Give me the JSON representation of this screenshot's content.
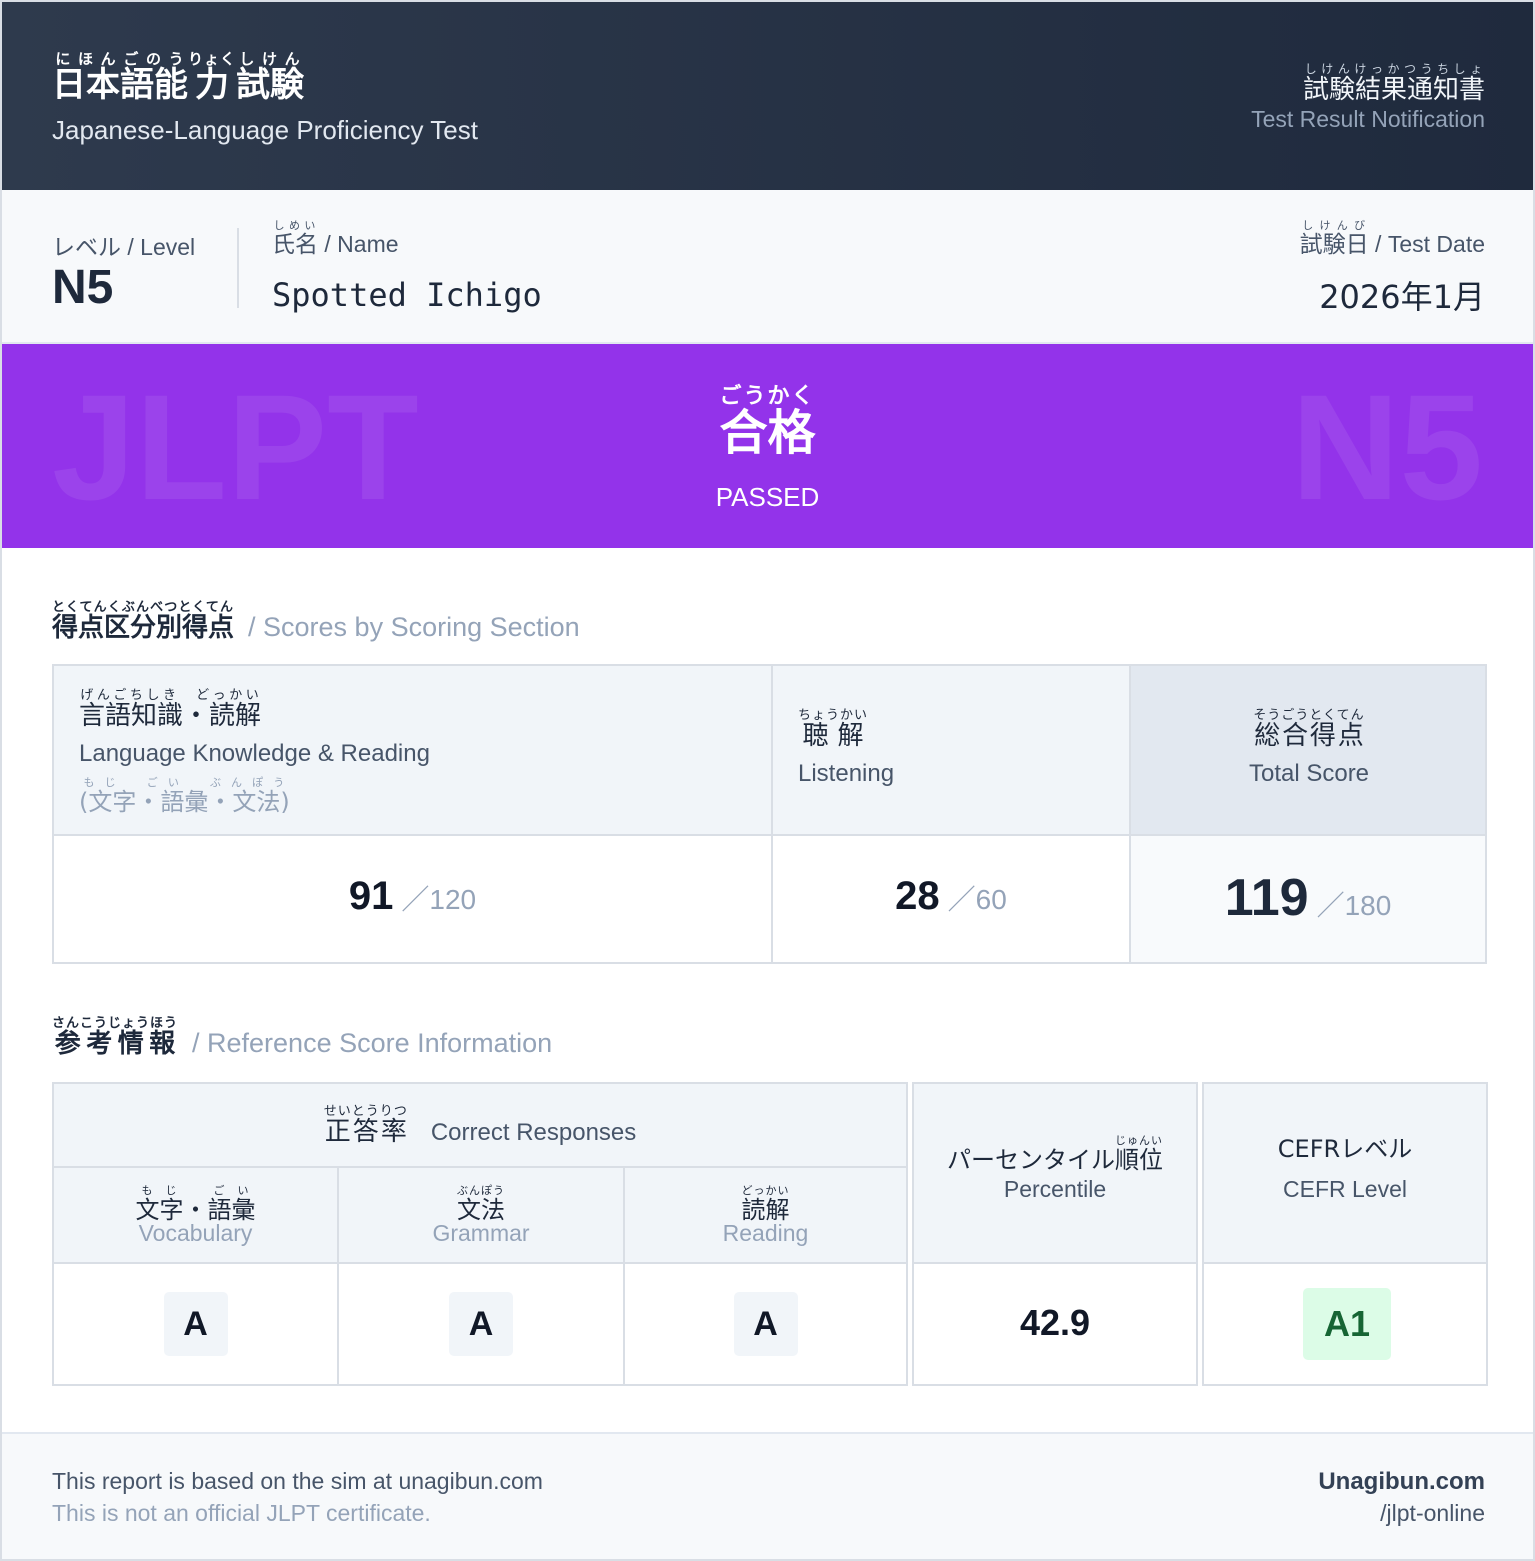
{
  "header": {
    "title_parts": [
      {
        "kanji": "日本語能",
        "reading": "にほんごのう"
      },
      {
        "kanji": "力",
        "reading": "りょく"
      },
      {
        "kanji": "試験",
        "reading": "しけん"
      }
    ],
    "subtitle": "Japanese-Language Proficiency Test",
    "notice_jp": "試験結果通知書",
    "notice_reading": "しけんけっかつうちしょ",
    "notice_en": "Test Result Notification"
  },
  "info": {
    "level_label": "レベル / Level",
    "level_value": "N5",
    "name_label_kanji": "氏名",
    "name_label_reading": "しめい",
    "name_label_en": " / Name",
    "name_value": "Spotted Ichigo",
    "date_label_kanji": "試験日",
    "date_label_reading": "しけんび",
    "date_label_en": " / Test Date",
    "date_value": "2026年1月"
  },
  "result": {
    "watermark_left": "JLPT",
    "watermark_right": "N5",
    "status_jp": "合格",
    "status_reading": "ごうかく",
    "status_en": "PASSED"
  },
  "scores_section": {
    "title_jp": "得点区分別得点",
    "title_reading": "とくてんくぶんべつとくてん",
    "title_en": "/ Scores by Scoring Section",
    "col1": {
      "jp": "言語知識・読解",
      "reading": "げんごちしき　どっかい",
      "en": "Language Knowledge & Reading",
      "sub": "(文字・語彙・文法)",
      "sub_reading": "もじ　ごい　ぶんぽう",
      "score": "91",
      "max": "120"
    },
    "col2": {
      "jp": "聴解",
      "reading": "ちょうかい",
      "en": "Listening",
      "score": "28",
      "max": "60"
    },
    "col3": {
      "jp": "総合得点",
      "reading": "そうごうとくてん",
      "en": "Total Score",
      "score": "119",
      "max": "180"
    },
    "slash": "／"
  },
  "reference_section": {
    "title_jp": "参考情報",
    "title_reading": "さんこうじょうほう",
    "title_en": "/ Reference Score Information",
    "correct": {
      "jp": "正答率",
      "reading": "せいとうりつ",
      "en": "Correct Responses",
      "items": [
        {
          "jp": "文字・語彙",
          "reading": "もじ　ごい",
          "en": "Vocabulary",
          "grade": "A"
        },
        {
          "jp": "文法",
          "reading": "ぶんぽう",
          "en": "Grammar",
          "grade": "A"
        },
        {
          "jp": "読解",
          "reading": "どっかい",
          "en": "Reading",
          "grade": "A"
        }
      ]
    },
    "percentile": {
      "jp": "パーセンタイル順位",
      "reading": "じゅんい",
      "en": "Percentile",
      "value": "42.9"
    },
    "cefr": {
      "jp": "CEFRレベル",
      "en": "CEFR Level",
      "value": "A1"
    }
  },
  "footer": {
    "line1": "This report is based on the sim at unagibun.com",
    "line2": "This is not an official JLPT certificate.",
    "brand": "Unagibun.com",
    "path": "/jlpt-online"
  }
}
